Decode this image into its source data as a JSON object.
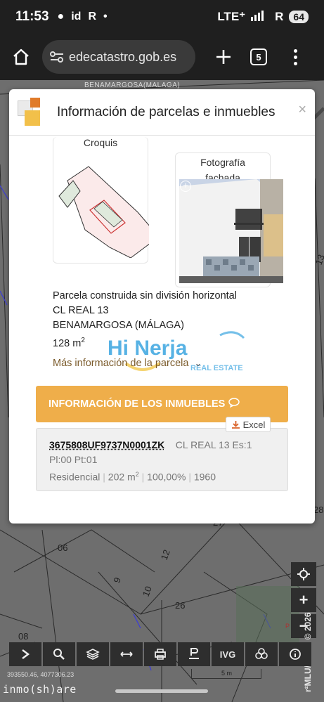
{
  "status_bar": {
    "time": "11:53",
    "left_icons": [
      "id",
      "R"
    ],
    "network": "LTE⁺",
    "signal": "R",
    "battery": "64"
  },
  "browser": {
    "url": "edecatastro.gob.es",
    "tab_count": "5"
  },
  "map": {
    "top_label": "BENAMARGOSA(MALAGA)",
    "parcel_numbers": [
      "06",
      "9",
      "10",
      "12",
      "26",
      "27",
      "28",
      "08",
      "13",
      "P"
    ],
    "coordinates": "393550.46, 4077306.23",
    "scale": "5 m",
    "copyright": "r²MLU/99 zib © 2026"
  },
  "modal": {
    "title": "Información de parcelas e inmuebles",
    "close": "×",
    "croquis_label": "Croquis",
    "foto_label_line1": "Fotografía",
    "foto_label_line2": "fachada",
    "parcel_type": "Parcela construida sin división horizontal",
    "address": "CL REAL 13",
    "municipality": "BENAMARGOSA (MÁLAGA)",
    "area_value": "128 m",
    "area_sup": "2",
    "more_info": "Más información de la parcela",
    "inmuebles_header": "INFORMACIÓN DE LOS INMUEBLES",
    "excel_label": "Excel",
    "inmueble": {
      "refcat": "3675808UF9737N0001ZK",
      "address": "CL REAL 13 Es:1",
      "floor": "Pl:00 Pt:01",
      "use": "Residencial",
      "area_value": "202 m",
      "area_sup": "2",
      "participation": "100,00%",
      "year": "1960"
    }
  },
  "watermark": {
    "text_hi": "Hi Nerja",
    "text_re": "REAL ESTATE"
  },
  "toolbar": {
    "ivg_label": "IVG"
  },
  "brand": "inmo(sh)are",
  "colors": {
    "accent": "#efae4a",
    "link": "#7a5a2a",
    "status_bg": "#1f1f1f"
  }
}
